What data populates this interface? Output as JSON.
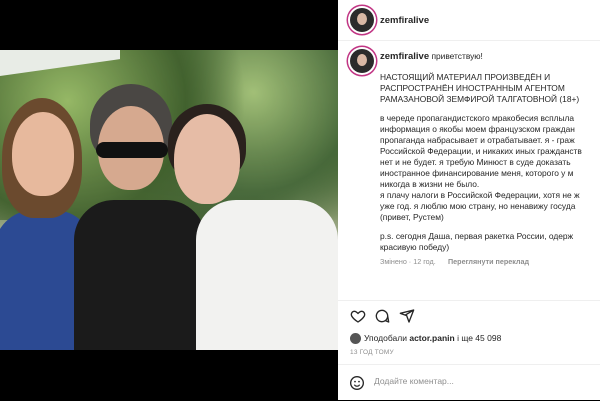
{
  "post": {
    "username": "zemfiralive",
    "greeting": "приветствую!",
    "caption_lines": [
      "НАСТОЯЩИЙ МАТЕРИАЛ ПРОИЗВЕДЁН И",
      "РАСПРОСТРАНЁН ИНОСТРАННЫМ АГЕНТОМ",
      "РАМАЗАНОВОЙ ЗЕМФИРОЙ ТАЛГАТОВНОЙ (18+)",
      "",
      "в череде пропагандистского мракобесия всплыла",
      "информация о якобы моем французском граждан",
      "пропаганда набрасывает и отрабатывает. я - граж",
      "Российской Федерации, и никаких иных гражданств",
      "нет и не будет. я требую Минюст в суде доказать",
      "иностранное финансирование меня, которого у м",
      "никогда в жизни не было.",
      "я плачу налоги в Российской Федерации, хотя не ж",
      "уже год. я люблю мою страну, но ненавижу госуда",
      "(привет, Рустем)",
      "",
      "p.s. сегодня Даша, первая ракетка России, одерж",
      "красивую победу)"
    ],
    "edited": "Змінено · 12 год.",
    "see_translation": "Переглянути переклад",
    "liked_by_prefix": "Уподобали",
    "liked_by_user": "actor.panin",
    "liked_by_suffix": "і ще 45 098",
    "timestamp": "13 ГОД ТОМУ",
    "comment_placeholder": "Додайте коментар..."
  },
  "icons": {
    "like": "heart-icon",
    "comment": "comment-icon",
    "share": "share-icon",
    "emoji": "emoji-icon"
  }
}
